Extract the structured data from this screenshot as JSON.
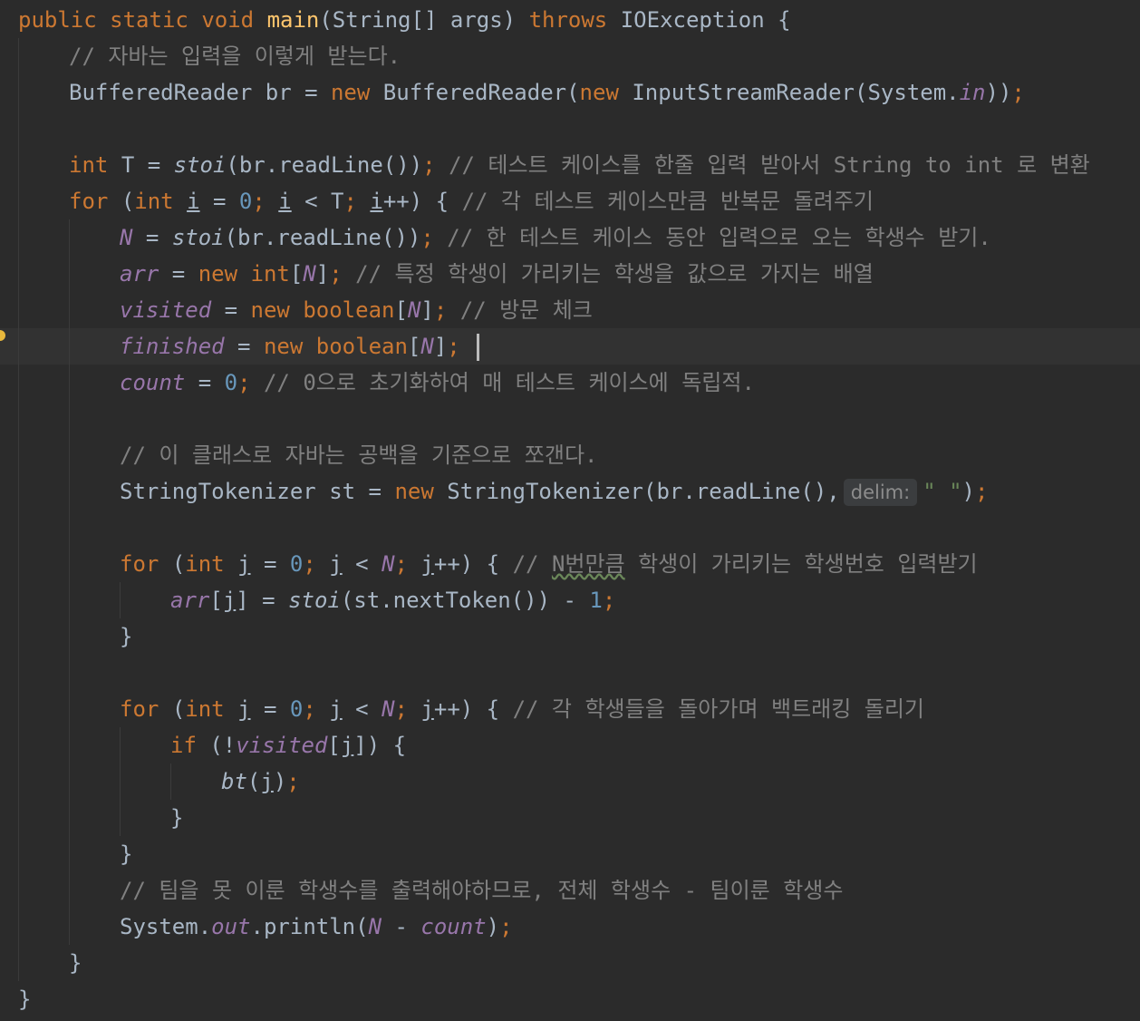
{
  "code": {
    "l1": {
      "k1": "public",
      "k2": "static",
      "k3": "void",
      "method": "main",
      "params": "(String[] args)",
      "k4": "throws",
      "exc": "IOException",
      "brace": "{"
    },
    "l2": {
      "comment": "// 자바는 입력을 이렇게 받는다."
    },
    "l3": {
      "type": "BufferedReader br = ",
      "kw1": "new",
      "ctor": "BufferedReader(",
      "kw2": "new",
      "ctor2": "InputStreamReader(System.",
      "fld": "in",
      "close": "))",
      "semi": ";"
    },
    "l4": {
      "kw": "int",
      "decl": "T = ",
      "call": "stoi",
      "args": "(br.readLine())",
      "semi": ";",
      "comment": "// 테스트 케이스를 한줄 입력 받아서 String to int 로 변환"
    },
    "l5": {
      "kw": "for",
      "p1": "(",
      "kw2": "int",
      "v1": "i",
      "eq": " = ",
      "n0": "0",
      "s1": ";",
      "v2": "i",
      "lt": " < T",
      "s2": ";",
      "v3": "i",
      "inc": "++) {",
      "comment": "// 각 테스트 케이스만큼 반복문 돌려주기"
    },
    "l6": {
      "fld": "N",
      "eq": " = ",
      "call": "stoi",
      "args": "(br.readLine())",
      "semi": ";",
      "comment": "// 한 테스트 케이스 동안 입력으로 오는 학생수 받기."
    },
    "l7": {
      "fld": "arr",
      "eq": " = ",
      "kw": "new",
      "t": "int",
      "ob": "[",
      "n": "N",
      "cb": "]",
      "semi": ";",
      "comment": "// 특정 학생이 가리키는 학생을 값으로 가지는 배열"
    },
    "l8": {
      "fld": "visited",
      "eq": " = ",
      "kw": "new",
      "t": "boolean",
      "ob": "[",
      "n": "N",
      "cb": "]",
      "semi": ";",
      "comment": "// 방문 체크"
    },
    "l9": {
      "fld": "finished",
      "eq": " = ",
      "kw": "new",
      "t": "boolean",
      "ob": "[",
      "n": "N",
      "cb": "]",
      "semi": ";"
    },
    "l10": {
      "fld": "count",
      "eq": " = ",
      "num": "0",
      "semi": ";",
      "comment": "// 0으로 초기화하여 매 테스트 케이스에 독립적."
    },
    "l11": {
      "comment": "// 이 클래스로 자바는 공백을 기준으로 쪼갠다."
    },
    "l12": {
      "text": "StringTokenizer st = ",
      "kw": "new",
      "call": "StringTokenizer(br.readLine(),",
      "hint": "delim:",
      "str": "\" \"",
      "close": ")",
      "semi": ";"
    },
    "l13": {
      "kw": "for",
      "p1": "(",
      "kw2": "int",
      "v1": "j",
      "eq": " = ",
      "n0": "0",
      "s1": ";",
      "v2": "j",
      "lt": " < ",
      "n": "N",
      "s2": ";",
      "v3": "j",
      "inc": "++) {",
      "c1": "// ",
      "c2": "N번만큼",
      "c3": " 학생이 가리키는 학생번호 입력받기"
    },
    "l14": {
      "fld": "arr",
      "ob": "[",
      "v": "j",
      "cb": "] = ",
      "call": "stoi",
      "args": "(st.nextToken()) - ",
      "num": "1",
      "semi": ";"
    },
    "l15": {
      "brace": "}"
    },
    "l16": {
      "kw": "for",
      "p1": "(",
      "kw2": "int",
      "v1": "j",
      "eq": " = ",
      "n0": "0",
      "s1": ";",
      "v2": "j",
      "lt": " < ",
      "n": "N",
      "s2": ";",
      "v3": "j",
      "inc": "++) {",
      "comment": "// 각 학생들을 돌아가며 백트래킹 돌리기"
    },
    "l17": {
      "kw": "if",
      "p": "(!",
      "fld": "visited",
      "ob": "[",
      "v": "j",
      "cb": "]) {"
    },
    "l18": {
      "call": "bt",
      "p": "(",
      "v": "j",
      "cp": ")",
      "semi": ";"
    },
    "l19": {
      "brace": "}"
    },
    "l20": {
      "brace": "}"
    },
    "l21": {
      "comment": "// 팀을 못 이룬 학생수를 출력해야하므로, 전체 학생수 - 팀이룬 학생수"
    },
    "l22": {
      "a": "System.",
      "fld": "out",
      "b": ".println(",
      "n": "N",
      "minus": " - ",
      "c": "count",
      "close": ")",
      "semi": ";"
    },
    "l23": {
      "brace": "}"
    },
    "l24": {
      "brace": "}"
    }
  }
}
